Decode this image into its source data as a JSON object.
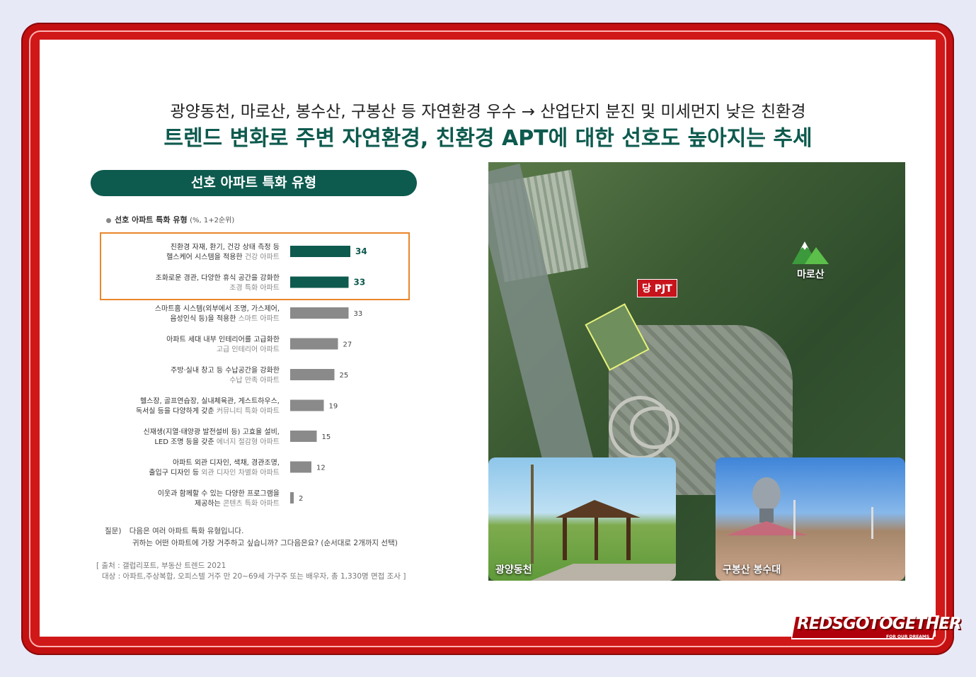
{
  "header": {
    "subtitle": "광양동천, 마로산, 봉수산, 구봉산 등 자연환경 우수 → 산업단지 분진 및 미세먼지 낮은 친환경",
    "headline": "트렌드 변화로 주변 자연환경, 친환경 APT에 대한 선호도 높아지는 추세"
  },
  "section_title": "선호 아파트 특화 유형",
  "legend": {
    "label": "선호 아파트 특화 유형",
    "note": "(%, 1+2순위)"
  },
  "colors": {
    "highlight": "#0d5a4e",
    "normal": "#8a8a8a",
    "accent_box": "#e9862a",
    "frame": "#c41010"
  },
  "chart_data": {
    "type": "bar",
    "orientation": "horizontal",
    "title": "선호 아파트 특화 유형",
    "unit": "%, 1+2순위",
    "categories": [
      {
        "line1": "친환경 자재, 환기, 건강 상태 측정 등",
        "line2_prefix": "헬스케어 시스템을 적용한 ",
        "line2_label": "건강 아파트"
      },
      {
        "line1": "조화로운 경관, 다양한 휴식 공간을 강화한",
        "line2_prefix": "",
        "line2_label": "조경 특화 아파트"
      },
      {
        "line1": "스마트홈 시스템(외부에서 조명, 가스제어,",
        "line2_prefix": "음성인식 등)을 적용한 ",
        "line2_label": "스마트 아파트"
      },
      {
        "line1": "아파트 세대 내부 인테리어를 고급화한",
        "line2_prefix": "",
        "line2_label": "고급 인테리어 아파트"
      },
      {
        "line1": "주방·실내 창고 등 수납공간을 강화한",
        "line2_prefix": "",
        "line2_label": "수납 만족 아파트"
      },
      {
        "line1": "헬스장, 골프연습장, 실내체육관, 게스트하우스,",
        "line2_prefix": "독서실 등을 다양하게 갖춘 ",
        "line2_label": "커뮤니티 특화 아파트"
      },
      {
        "line1": "신재생(지열·태양광 발전설비 등) 고효율 설비,",
        "line2_prefix": "LED 조명 등을 갖춘 ",
        "line2_label": "에너지 절감형 아파트"
      },
      {
        "line1": "아파트 외관 디자인, 색채, 경관조명,",
        "line2_prefix": "출입구 디자인 등 ",
        "line2_label": "외관 디자인 차별화 아파트"
      },
      {
        "line1": "이웃과 함께할 수 있는 다양한 프로그램을",
        "line2_prefix": "제공하는 ",
        "line2_label": "콘텐츠 특화 아파트"
      }
    ],
    "values": [
      34,
      33,
      33,
      27,
      25,
      19,
      15,
      12,
      2
    ],
    "highlighted": [
      true,
      true,
      false,
      false,
      false,
      false,
      false,
      false,
      false
    ],
    "xlim": [
      0,
      40
    ]
  },
  "question": {
    "label": "질문)",
    "line1": "다음은 여러 아파트 특화 유형입니다.",
    "line2": "귀하는 어떤 아파트에 가장 거주하고 싶습니까? 그다음은요? (순서대로 2개까지 선택)"
  },
  "source": {
    "line1": "[ 출처 : 갤럽리포트, 부동산 트렌드 2021",
    "line2": "대상 : 아파트,주상복합, 오피스텔 거주 만 20~69세 가구주 또는 배우자, 총 1,330명 면접 조사 ]"
  },
  "map": {
    "project_tag": "당 PJT",
    "mountain_label": "마로산",
    "mountain_icon": "mountain-icon",
    "photo1_label": "광양동천",
    "photo2_label": "구봉산 봉수대"
  },
  "logo": {
    "text": "REDSGOTOGETHER",
    "sub": "FOR OUR DREAMS"
  }
}
